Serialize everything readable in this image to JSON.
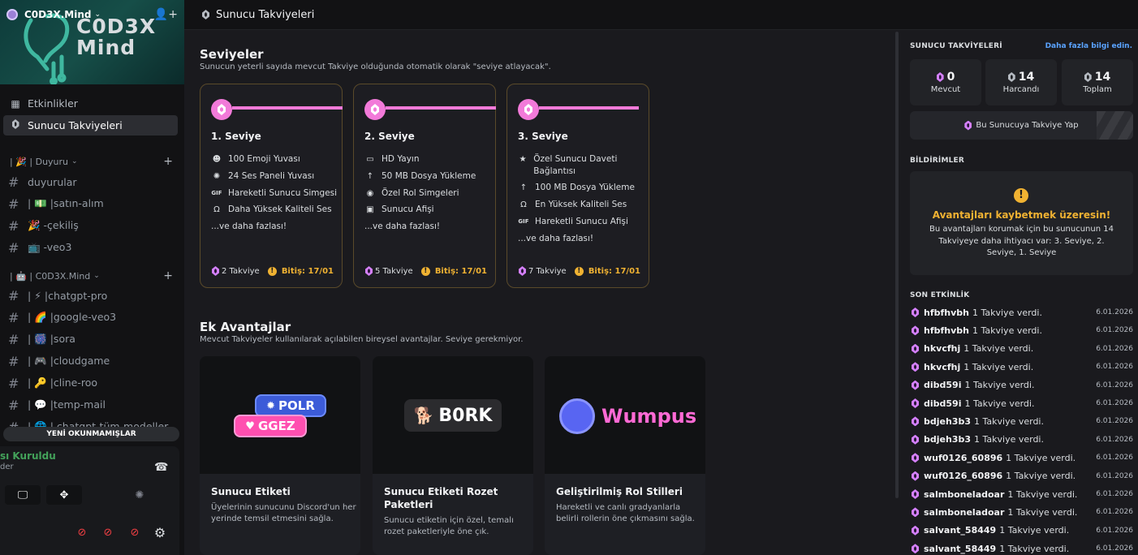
{
  "server": {
    "name": "C0D3X.Mind",
    "banner_text_line1": "C0D3X",
    "banner_text_line2": "Mind"
  },
  "sidebar": {
    "items": [
      {
        "label": "Etkinlikler",
        "icon": "calendar-icon"
      },
      {
        "label": "Sunucu Takviyeleri",
        "icon": "boost-gem-icon"
      }
    ],
    "categories": [
      {
        "label": "| 🎉 | Duyuru",
        "channels": [
          "duyurular",
          "| 💵 |satın-alım",
          "🎉 -çekiliş",
          "📺 -veo3"
        ]
      },
      {
        "label": "| 🤖 | C0D3X.Mind",
        "channels": [
          "| ⚡ |chatgpt-pro",
          "| 🌈 |google-veo3",
          "| 🎆 |sora",
          "| 🎮 |cloudgame",
          "| 🔑 |cline-roo",
          "| 💬 |temp-mail",
          "| 🌐 | chatgpt-tüm-modeller"
        ]
      }
    ],
    "unread_label": "YENİ OKUNMAMIŞLAR"
  },
  "voice": {
    "title": "sı Kuruldu",
    "subtitle": "der"
  },
  "topbar": {
    "title": "Sunucu Takviyeleri"
  },
  "levels": {
    "title": "Seviyeler",
    "subtitle": "Sunucun yeterli sayıda mevcut Takviye olduğunda otomatik olarak \"seviye atlayacak\".",
    "tiers": [
      {
        "name": "1. Seviye",
        "perks": [
          {
            "icon": "emoji-icon",
            "text": "100 Emoji Yuvası"
          },
          {
            "icon": "soundboard-icon",
            "text": "24 Ses Paneli Yuvası"
          },
          {
            "icon": "gif-icon",
            "text": "Hareketli Sunucu Simgesi"
          },
          {
            "icon": "headphones-icon",
            "text": "Daha Yüksek Kaliteli Ses"
          }
        ],
        "more": "...ve daha fazlası!",
        "boosts": "2 Takviye",
        "expires": "Bitiş: 17/01"
      },
      {
        "name": "2. Seviye",
        "perks": [
          {
            "icon": "screen-icon",
            "text": "HD Yayın"
          },
          {
            "icon": "upload-icon",
            "text": "50 MB Dosya Yükleme"
          },
          {
            "icon": "role-icon",
            "text": "Özel Rol Simgeleri"
          },
          {
            "icon": "banner-icon",
            "text": "Sunucu Afişi"
          }
        ],
        "more": "...ve daha fazlası!",
        "boosts": "5 Takviye",
        "expires": "Bitiş: 17/01"
      },
      {
        "name": "3. Seviye",
        "perks": [
          {
            "icon": "star-icon",
            "text": "Özel Sunucu Daveti Bağlantısı"
          },
          {
            "icon": "upload-icon",
            "text": "100 MB Dosya Yükleme"
          },
          {
            "icon": "headphones-icon",
            "text": "En Yüksek Kaliteli Ses"
          },
          {
            "icon": "gif-icon",
            "text": "Hareketli Sunucu Afişi"
          }
        ],
        "more": "...ve daha fazlası!",
        "boosts": "7 Takviye",
        "expires": "Bitiş: 17/01"
      }
    ]
  },
  "extra": {
    "title": "Ek Avantajlar",
    "subtitle": "Mevcut Takviyeler kullanılarak açılabilen bireysel avantajlar. Seviye gerekmiyor.",
    "cards": [
      {
        "title": "Sunucu Etiketi",
        "desc": "Üyelerinin sunucunu Discord'un her yerinde temsil etmesini sağla.",
        "art1": "POLR",
        "art2": "GGEZ"
      },
      {
        "title": "Sunucu Etiketi Rozet Paketleri",
        "desc": "Sunucu etiketin için özel, temalı rozet paketleriyle öne çık.",
        "art1": "B0RK"
      },
      {
        "title": "Geliştirilmiş Rol Stilleri",
        "desc": "Hareketli ve canlı gradyanlarla belirli rollerin öne çıkmasını sağla.",
        "art1": "Wumpus"
      }
    ]
  },
  "right": {
    "boosts_title": "SUNUCU TAKVİYELERİ",
    "learn_more": "Daha fazla bilgi edin.",
    "stats": [
      {
        "value": "0",
        "label": "Mevcut"
      },
      {
        "value": "14",
        "label": "Harcandı"
      },
      {
        "value": "14",
        "label": "Toplam"
      }
    ],
    "boost_button": "Bu Sunucuya Takviye Yap",
    "notif_title_header": "BİLDİRİMLER",
    "notif_heading": "Avantajları kaybetmek üzeresin!",
    "notif_body": "Bu avantajları korumak için bu sunucunun 14 Takviyeye daha ihtiyacı var: 3. Seviye, 2. Seviye, 1. Seviye",
    "activity_title": "SON ETKİNLİK",
    "activity": [
      {
        "user": "hfbfhvbh",
        "action": "1 Takviye verdi.",
        "date": "6.01.2026"
      },
      {
        "user": "hfbfhvbh",
        "action": "1 Takviye verdi.",
        "date": "6.01.2026"
      },
      {
        "user": "hkvcfhj",
        "action": "1 Takviye verdi.",
        "date": "6.01.2026"
      },
      {
        "user": "hkvcfhj",
        "action": "1 Takviye verdi.",
        "date": "6.01.2026"
      },
      {
        "user": "dibd59i",
        "action": "1 Takviye verdi.",
        "date": "6.01.2026"
      },
      {
        "user": "dibd59i",
        "action": "1 Takviye verdi.",
        "date": "6.01.2026"
      },
      {
        "user": "bdjeh3b3",
        "action": "1 Takviye verdi.",
        "date": "6.01.2026"
      },
      {
        "user": "bdjeh3b3",
        "action": "1 Takviye verdi.",
        "date": "6.01.2026"
      },
      {
        "user": "wuf0126_60896",
        "action": "1 Takviye verdi.",
        "date": "6.01.2026"
      },
      {
        "user": "wuf0126_60896",
        "action": "1 Takviye verdi.",
        "date": "6.01.2026"
      },
      {
        "user": "salmboneladoar",
        "action": "1 Takviye verdi.",
        "date": "6.01.2026"
      },
      {
        "user": "salmboneladoar",
        "action": "1 Takviye verdi.",
        "date": "6.01.2026"
      },
      {
        "user": "salvant_58449",
        "action": "1 Takviye verdi.",
        "date": "6.01.2026"
      },
      {
        "user": "salvant_58449",
        "action": "1 Takviye verdi.",
        "date": "6.01.2026"
      }
    ]
  },
  "colors": {
    "boost_pink": "#f27ad9",
    "warning": "#f0b232",
    "link": "#5aa3ff",
    "voice_green": "#43a25a"
  }
}
